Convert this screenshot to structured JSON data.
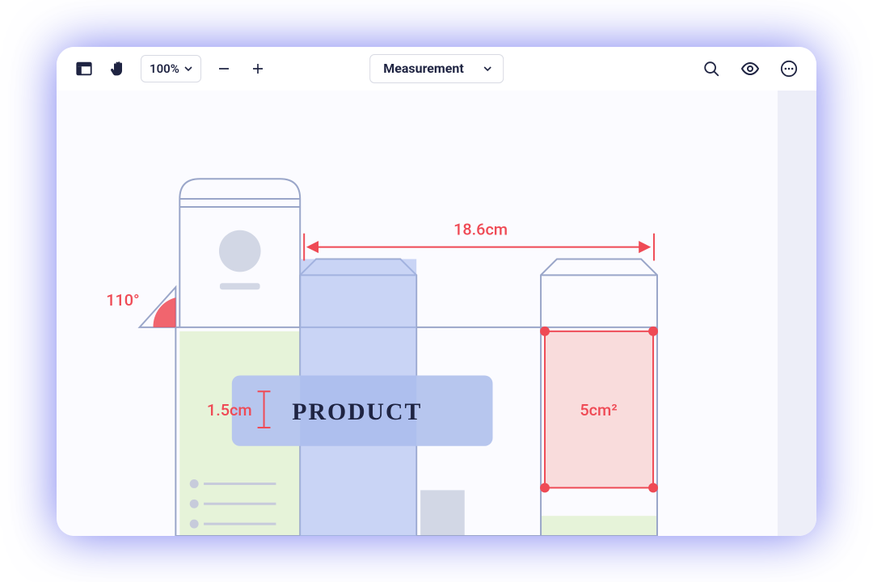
{
  "toolbar": {
    "zoom": "100%",
    "mode_label": "Measurement"
  },
  "canvas": {
    "product_label": "PRODUCT",
    "measurements": {
      "width": "18.6cm",
      "angle": "110°",
      "text_height": "1.5cm",
      "area": "5cm²"
    }
  },
  "colors": {
    "accent_red": "#ef4a55",
    "dieline_blue": "#9aa6c9",
    "panel_blue": "#a9bbee",
    "panel_green": "#e6f3d9",
    "panel_pink": "#f9dcdc"
  }
}
